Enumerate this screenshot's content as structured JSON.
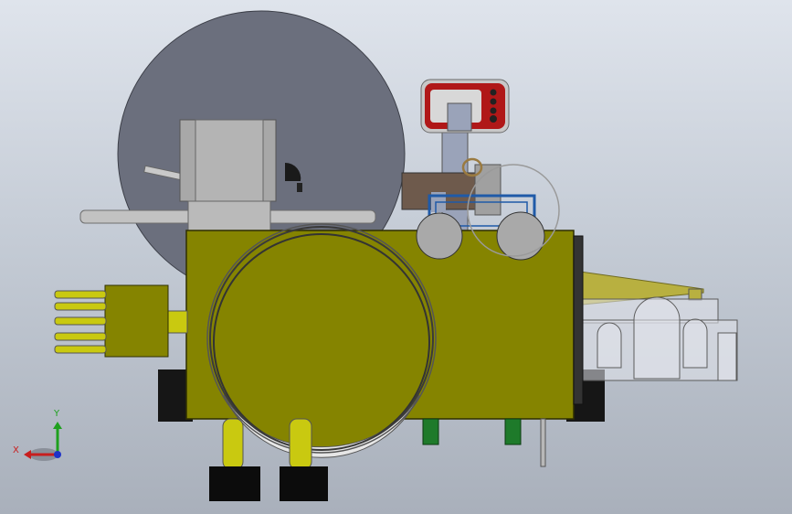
{
  "view": {
    "background_top": "#dfe4ec",
    "background_bottom": "#a9b0bb"
  },
  "triad": {
    "x_label": "X",
    "y_label": "Y",
    "x_color": "#c81e1e",
    "y_color": "#1ea01e",
    "z_color": "#1e32c8"
  },
  "model": {
    "body_color": "#858400",
    "rod_color": "#c9c910",
    "disc_color": "#6b6f7d",
    "block_color": "#b9b9b9",
    "foot_color": "#0c0c0c",
    "display_color": "#b01818",
    "bracket_color": "#6e5a4c",
    "frame_color": "#1f5aa8",
    "nozzle_color": "#b8b040",
    "green_post_color": "#1e7a2a"
  }
}
